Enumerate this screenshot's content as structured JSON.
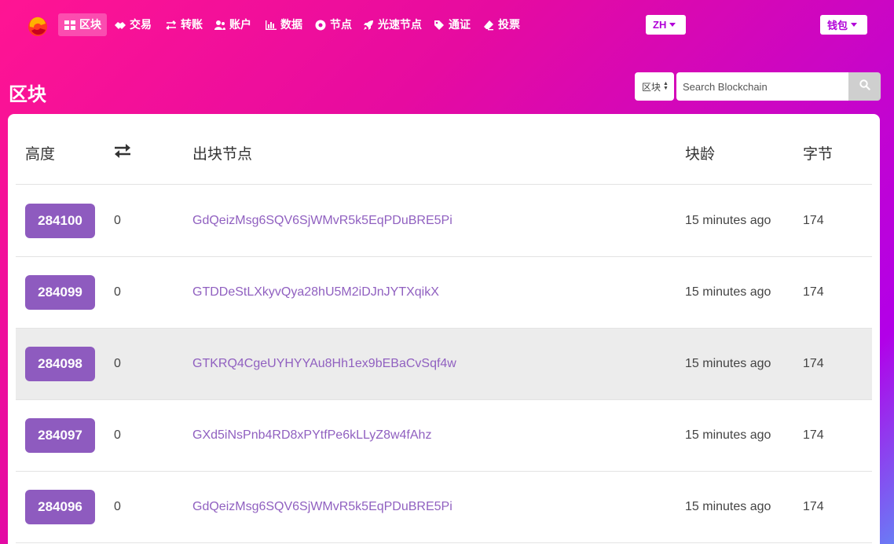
{
  "nav": {
    "items": [
      {
        "label": "区块",
        "icon": "grid-icon"
      },
      {
        "label": "交易",
        "icon": "handshake-icon"
      },
      {
        "label": "转账",
        "icon": "exchange-icon"
      },
      {
        "label": "账户",
        "icon": "users-icon"
      },
      {
        "label": "数据",
        "icon": "bar-chart-icon"
      },
      {
        "label": "节点",
        "icon": "dot-circle-icon"
      },
      {
        "label": "光速节点",
        "icon": "rocket-icon"
      },
      {
        "label": "通证",
        "icon": "tag-icon"
      },
      {
        "label": "投票",
        "icon": "eraser-icon"
      }
    ],
    "language": "ZH",
    "wallet": "钱包"
  },
  "page": {
    "title": "区块"
  },
  "search": {
    "type": "区块",
    "placeholder": "Search Blockchain"
  },
  "table": {
    "headers": {
      "height": "高度",
      "tx_icon": "exchange-icon",
      "producer": "出块节点",
      "age": "块龄",
      "bytes": "字节"
    },
    "rows": [
      {
        "height": "284100",
        "tx": "0",
        "producer": "GdQeizMsg6SQV6SjWMvR5k5EqPDuBRE5Pi",
        "age": "15 minutes ago",
        "bytes": "174"
      },
      {
        "height": "284099",
        "tx": "0",
        "producer": "GTDDeStLXkyvQya28hU5M2iDJnJYTXqikX",
        "age": "15 minutes ago",
        "bytes": "174"
      },
      {
        "height": "284098",
        "tx": "0",
        "producer": "GTKRQ4CgeUYHYYAu8Hh1ex9bEBaCvSqf4w",
        "age": "15 minutes ago",
        "bytes": "174"
      },
      {
        "height": "284097",
        "tx": "0",
        "producer": "GXd5iNsPnb4RD8xPYtfPe6kLLyZ8w4fAhz",
        "age": "15 minutes ago",
        "bytes": "174"
      },
      {
        "height": "284096",
        "tx": "0",
        "producer": "GdQeizMsg6SQV6SjWMvR5k5EqPDuBRE5Pi",
        "age": "15 minutes ago",
        "bytes": "174"
      }
    ]
  },
  "colors": {
    "badge": "#8e5bbf",
    "link": "#9060c0",
    "accent": "#b100d8"
  }
}
